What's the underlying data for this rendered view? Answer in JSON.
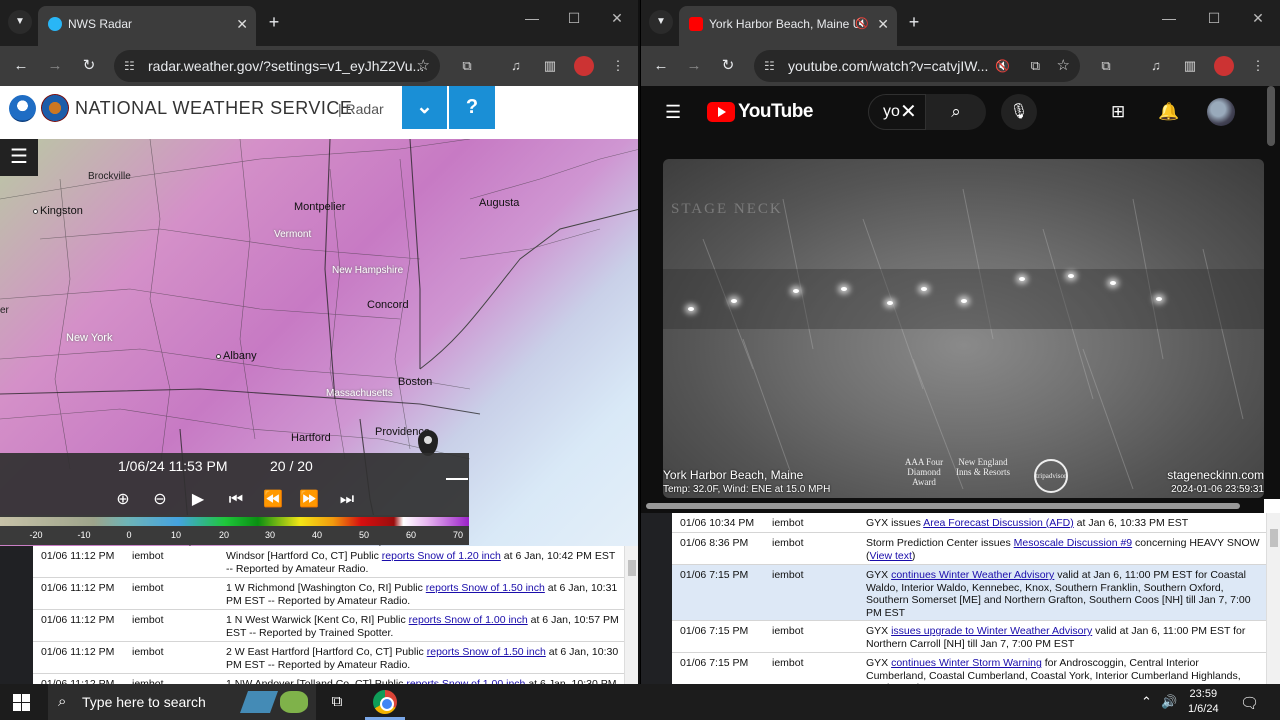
{
  "left_browser": {
    "tab_title": "NWS Radar",
    "url": "radar.weather.gov/?settings=v1_eyJhZ2Vu...",
    "nws_title": "NATIONAL WEATHER SERVICE",
    "nws_sub": "| Radar",
    "help_label": "?",
    "map_labels": {
      "brockville": "Brockville",
      "kingston": "Kingston",
      "montpelier": "Montpelier",
      "vermont": "Vermont",
      "augusta": "Augusta",
      "new_hampshire": "New Hampshire",
      "concord": "Concord",
      "new_york": "New York",
      "albany": "Albany",
      "boston": "Boston",
      "massachusetts": "Massachusetts",
      "hartford": "Hartford",
      "providence": "Providence",
      "er": "er"
    },
    "player": {
      "timestamp": "1/06/24 11:53 PM",
      "frame": "20 / 20"
    },
    "legend_ticks": [
      "-20",
      "-10",
      "0",
      "10",
      "20",
      "30",
      "40",
      "50",
      "60",
      "70"
    ],
    "events": [
      {
        "time": "01/06 11:12 PM",
        "user": "iembot",
        "pre": "Windsor [Hartford Co, CT] Public ",
        "link": "reports Snow of 1.20 inch",
        "post": " at 6 Jan, 10:42 PM EST -- Reported by Amateur Radio."
      },
      {
        "time": "01/06 11:12 PM",
        "user": "iembot",
        "pre": "1 W Richmond [Washington Co, RI] Public ",
        "link": "reports Snow of 1.50 inch",
        "post": " at 6 Jan, 10:31 PM EST -- Reported by Amateur Radio."
      },
      {
        "time": "01/06 11:12 PM",
        "user": "iembot",
        "pre": "1 N West Warwick [Kent Co, RI] Public ",
        "link": "reports Snow of 1.00 inch",
        "post": " at 6 Jan, 10:57 PM EST -- Reported by Trained Spotter."
      },
      {
        "time": "01/06 11:12 PM",
        "user": "iembot",
        "pre": "2 W East Hartford [Hartford Co, CT] Public ",
        "link": "reports Snow of 1.50 inch",
        "post": " at 6 Jan, 10:30 PM EST -- Reported by Amateur Radio."
      },
      {
        "time": "01/06 11:12 PM",
        "user": "iembot",
        "pre": "1 NW Andover [Tolland Co, CT] Public ",
        "link": "reports Snow of 1.00 inch",
        "post": " at 6 Jan, 10:30 PM"
      }
    ]
  },
  "right_browser": {
    "tab_title": "York Harbor Beach, Maine U",
    "url": "youtube.com/watch?v=catvjIW...",
    "yt_word": "YouTube",
    "search_value": "yo",
    "video": {
      "watermark": "STAGE NECK",
      "location": "York Harbor Beach, Maine",
      "conditions": "Temp: 32.0F, Wind: ENE at 15.0 MPH",
      "site": "stageneckinn.com",
      "stamp": "2024-01-06 23:59:31",
      "logo1": "AAA Four Diamond Award",
      "logo2": "New England Inns & Resorts",
      "logo3": "tripadvisor"
    },
    "events": [
      {
        "time": "01/06 10:34 PM",
        "user": "iembot",
        "pre": "GYX issues ",
        "link": "Area Forecast Discussion (AFD)",
        "post": " at Jan 6, 10:33 PM EST"
      },
      {
        "time": "01/06 8:36 PM",
        "user": "iembot",
        "pre": "Storm Prediction Center issues ",
        "link": "Mesoscale Discussion #9",
        "post": " concerning HEAVY SNOW (",
        "link2": "View text",
        "post2": ")"
      },
      {
        "time": "01/06 7:15 PM",
        "user": "iembot",
        "pre": "GYX ",
        "link": "continues Winter Weather Advisory",
        "post": " valid at Jan 6, 11:00 PM EST for Coastal Waldo, Interior Waldo, Kennebec, Knox, Southern Franklin, Southern Oxford, Southern Somerset [ME] and Northern Grafton, Southern Coos [NH] till Jan 7, 7:00 PM EST"
      },
      {
        "time": "01/06 7:15 PM",
        "user": "iembot",
        "pre": "GYX ",
        "link": "issues upgrade to Winter Weather Advisory",
        "post": " valid at Jan 6, 11:00 PM EST for Northern Carroll [NH] till Jan 7, 7:00 PM EST"
      },
      {
        "time": "01/06 7:15 PM",
        "user": "iembot",
        "pre": "GYX ",
        "link": "continues Winter Storm Warning",
        "post": " for Androscoggin, Central Interior Cumberland, Coastal Cumberland, Coastal York, Interior Cumberland Highlands, Interior York,"
      }
    ]
  },
  "taskbar": {
    "search_placeholder": "Type here to search",
    "time": "23:59",
    "date": "1/6/24"
  },
  "colors": {
    "nws_blue": "#1a8fd6",
    "youtube_red": "#ff0000",
    "link": "#1a0dab"
  }
}
